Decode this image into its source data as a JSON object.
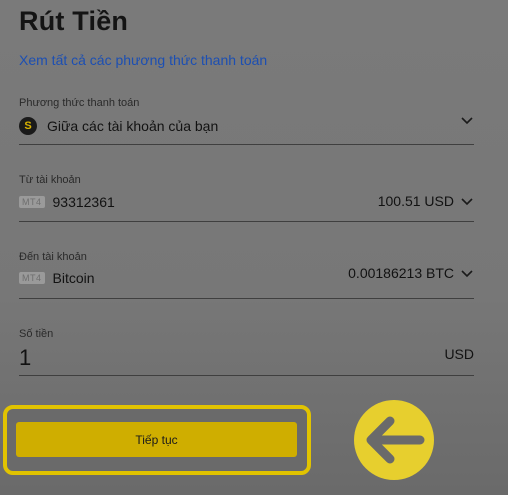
{
  "page": {
    "title": "Rút Tiền",
    "view_all_link": "Xem tất cả các phương thức thanh toán"
  },
  "payment_method": {
    "label": "Phương thức thanh toán",
    "value": "Giữa các tài khoản của bạn",
    "icon": "coin-icon"
  },
  "from_account": {
    "label": "Từ tài khoản",
    "badge": "MT4",
    "account": "93312361",
    "balance": "100.51 USD"
  },
  "to_account": {
    "label": "Đến tài khoản",
    "badge": "MT4",
    "account": "Bitcoin",
    "balance": "0.00186213 BTC"
  },
  "amount": {
    "label": "Số tiền",
    "value": "1",
    "currency": "USD"
  },
  "actions": {
    "continue_label": "Tiếp tục"
  },
  "colors": {
    "accent": "#e1c300",
    "button": "#cfae00",
    "link": "#1c4fb3"
  }
}
